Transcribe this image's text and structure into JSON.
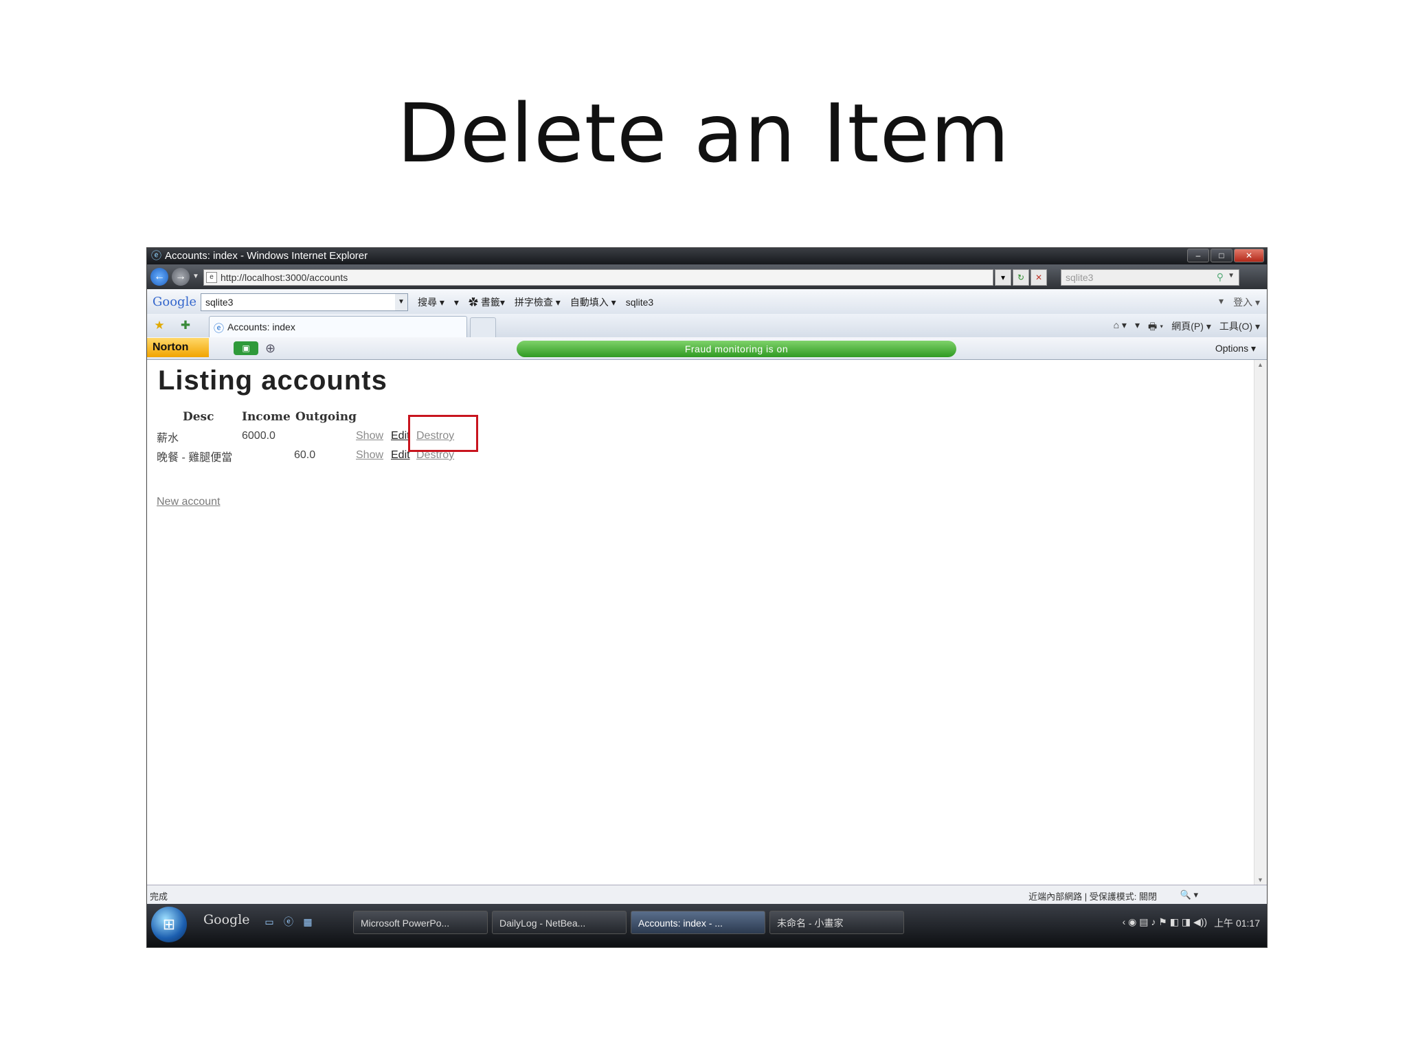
{
  "slide": {
    "title": "Delete an Item"
  },
  "window": {
    "title": "Accounts: index - Windows Internet Explorer",
    "controls": {
      "minimize": "–",
      "maximize": "□",
      "close": "✕"
    }
  },
  "navbar": {
    "back_glyph": "←",
    "forward_glyph": "→",
    "url": "http://localhost:3000/accounts",
    "search_value": "sqlite3"
  },
  "google_toolbar": {
    "logo": "Google",
    "search_value": "sqlite3",
    "items": [
      "搜尋 ▾",
      "▾",
      "✿ 書籤▾",
      "拼字檢查 ▾",
      "自動填入 ▾",
      "sqlite3"
    ],
    "right_items": [
      "▾",
      "登入 ▾"
    ]
  },
  "tabs": {
    "active_tab": "Accounts: index",
    "commands": [
      "⌂ ▾",
      "▾",
      "🖶 ▾",
      "網頁(P) ▾",
      "工具(O) ▾"
    ]
  },
  "norton": {
    "logo": "Norton",
    "status": "Fraud monitoring is on",
    "options": "Options ▾"
  },
  "page": {
    "heading": "Listing accounts",
    "columns": {
      "desc": "Desc",
      "income": "Income",
      "outgoing": "Outgoing"
    },
    "rows": [
      {
        "desc": "薪水",
        "income": "6000.0",
        "outgoing": "",
        "show": "Show",
        "edit": "Edit",
        "destroy": "Destroy"
      },
      {
        "desc": "晚餐 - 雞腿便當",
        "income": "",
        "outgoing": "60.0",
        "show": "Show",
        "edit": "Edit",
        "destroy": "Destroy"
      }
    ],
    "new_account": "New account"
  },
  "statusbar": {
    "status": "完成",
    "zone": "近端內部網路 | 受保護模式: 關閉",
    "zoom": "🔍 ▾"
  },
  "taskbar": {
    "google": "Google",
    "buttons": [
      "Microsoft PowerPo...",
      "DailyLog - NetBea...",
      "Accounts: index - ...",
      "未命名 - 小畫家"
    ],
    "clock": "上午 01:17"
  },
  "colors": {
    "highlight_box": "#c8141e",
    "fraud_bar": "#2f9a22",
    "norton_logo": "#f1a400"
  }
}
